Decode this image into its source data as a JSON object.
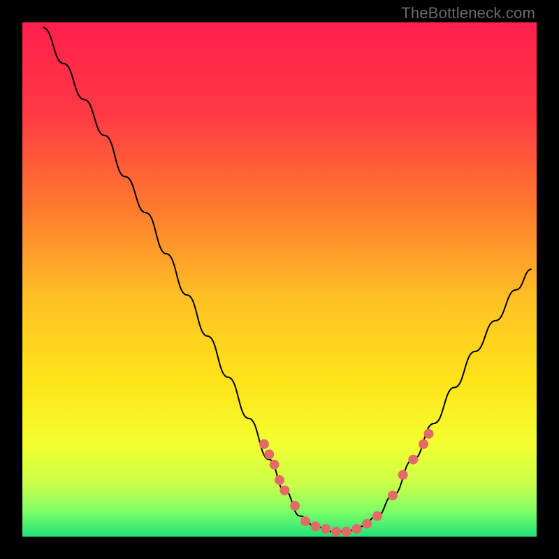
{
  "watermark": "TheBottleneck.com",
  "chart_data": {
    "type": "line",
    "title": "",
    "xlabel": "",
    "ylabel": "",
    "xlim": [
      0,
      100
    ],
    "ylim": [
      0,
      100
    ],
    "background_gradient_stops": [
      {
        "offset": 0.0,
        "color": "#ff1f4d"
      },
      {
        "offset": 0.18,
        "color": "#ff3a44"
      },
      {
        "offset": 0.36,
        "color": "#ff7a2f"
      },
      {
        "offset": 0.54,
        "color": "#ffc224"
      },
      {
        "offset": 0.7,
        "color": "#ffe41a"
      },
      {
        "offset": 0.82,
        "color": "#f4ff30"
      },
      {
        "offset": 0.9,
        "color": "#c8ff4a"
      },
      {
        "offset": 0.95,
        "color": "#7fff66"
      },
      {
        "offset": 1.0,
        "color": "#22e27a"
      }
    ],
    "series": [
      {
        "name": "bottleneck-curve",
        "type": "line",
        "color": "#000000",
        "points": [
          {
            "x": 4,
            "y": 99
          },
          {
            "x": 8,
            "y": 92
          },
          {
            "x": 12,
            "y": 85
          },
          {
            "x": 16,
            "y": 78
          },
          {
            "x": 20,
            "y": 70
          },
          {
            "x": 24,
            "y": 63
          },
          {
            "x": 28,
            "y": 55
          },
          {
            "x": 32,
            "y": 47
          },
          {
            "x": 36,
            "y": 39
          },
          {
            "x": 40,
            "y": 31
          },
          {
            "x": 44,
            "y": 23
          },
          {
            "x": 48,
            "y": 15
          },
          {
            "x": 51,
            "y": 9
          },
          {
            "x": 54,
            "y": 4
          },
          {
            "x": 57,
            "y": 2
          },
          {
            "x": 60,
            "y": 1
          },
          {
            "x": 63,
            "y": 1
          },
          {
            "x": 66,
            "y": 2
          },
          {
            "x": 69,
            "y": 4
          },
          {
            "x": 72,
            "y": 8
          },
          {
            "x": 76,
            "y": 15
          },
          {
            "x": 80,
            "y": 22
          },
          {
            "x": 84,
            "y": 29
          },
          {
            "x": 88,
            "y": 36
          },
          {
            "x": 92,
            "y": 42
          },
          {
            "x": 96,
            "y": 48
          },
          {
            "x": 99,
            "y": 52
          }
        ]
      },
      {
        "name": "highlighted-markers",
        "type": "scatter",
        "color": "#e46a6a",
        "points": [
          {
            "x": 47,
            "y": 18
          },
          {
            "x": 48,
            "y": 16
          },
          {
            "x": 49,
            "y": 14
          },
          {
            "x": 50,
            "y": 11
          },
          {
            "x": 51,
            "y": 9
          },
          {
            "x": 53,
            "y": 6
          },
          {
            "x": 55,
            "y": 3
          },
          {
            "x": 57,
            "y": 2
          },
          {
            "x": 59,
            "y": 1.5
          },
          {
            "x": 61,
            "y": 1
          },
          {
            "x": 63,
            "y": 1
          },
          {
            "x": 65,
            "y": 1.5
          },
          {
            "x": 67,
            "y": 2.5
          },
          {
            "x": 69,
            "y": 4
          },
          {
            "x": 72,
            "y": 8
          },
          {
            "x": 74,
            "y": 12
          },
          {
            "x": 76,
            "y": 15
          },
          {
            "x": 78,
            "y": 18
          },
          {
            "x": 79,
            "y": 20
          }
        ]
      }
    ]
  }
}
